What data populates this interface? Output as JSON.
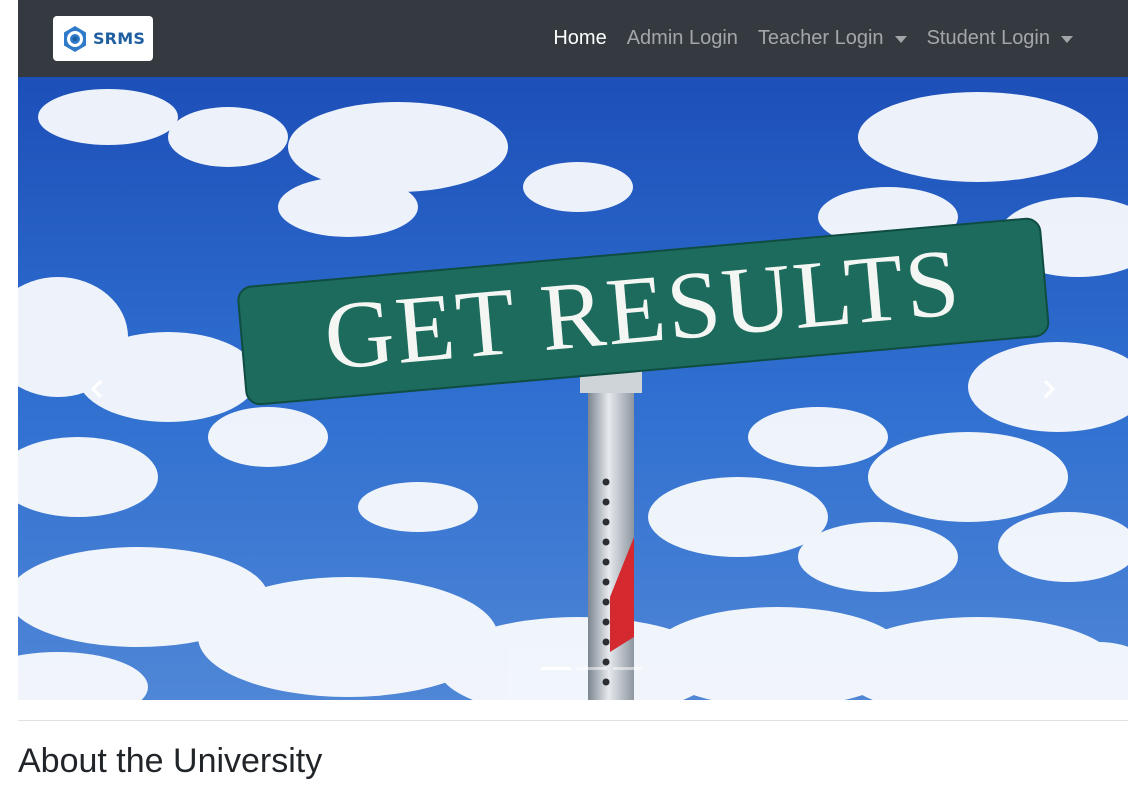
{
  "brand": {
    "text": "SRMS",
    "logo_icon": "hexagon-ring-logo-icon"
  },
  "nav": {
    "home": "Home",
    "admin_login": "Admin Login",
    "teacher_login": "Teacher Login",
    "student_login": "Student Login"
  },
  "carousel": {
    "slide_image": "Get Results street sign against blue sky",
    "prev_icon": "chevron-left-icon",
    "next_icon": "chevron-right-icon",
    "indicator_count": 3,
    "active_slide": 1
  },
  "about": {
    "title": "About the University"
  },
  "colors": {
    "navbar_bg": "#343a40",
    "brand_text": "#1f5fa0",
    "sign_green": "#1c6b5c",
    "sky_blue": "#2a63c4"
  }
}
